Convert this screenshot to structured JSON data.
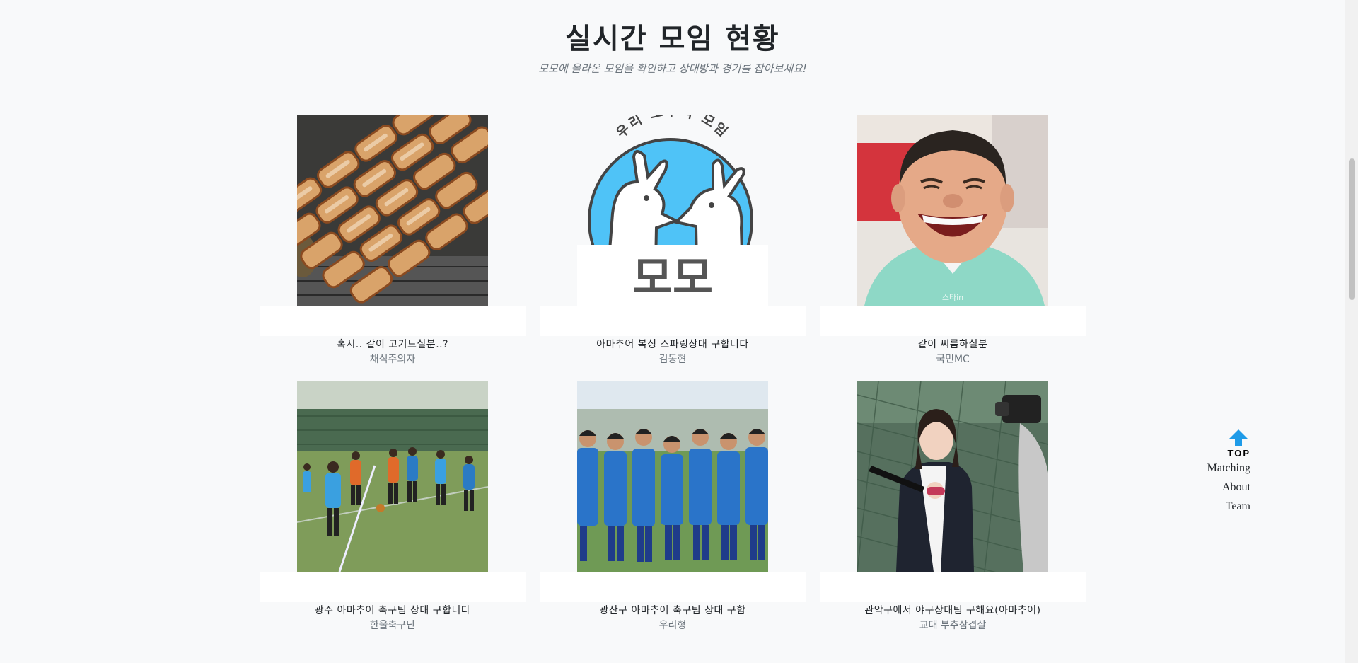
{
  "section": {
    "heading": "실시간 모임 현황",
    "subheading": "모모에 올라온 모임을 확인하고 상대방과 경기를 잡아보세요!"
  },
  "cards": [
    {
      "title": "혹시.. 같이 고기드실분..?",
      "author": "채식주의자",
      "image": "grilled-pork-belly"
    },
    {
      "title": "아마추어 복싱 스파링상대 구합니다",
      "author": "김동현",
      "image": "momo-logo"
    },
    {
      "title": "같이 씨름하실분",
      "author": "국민MC",
      "image": "laughing-man"
    },
    {
      "title": "광주 아마추어 축구팀 상대 구합니다",
      "author": "한울축구단",
      "image": "soccer-match"
    },
    {
      "title": "광산구 아마추어 축구팀 상대 구함",
      "author": "우리형",
      "image": "soccer-team"
    },
    {
      "title": "관악구에서 야구상대팀 구해요(아마추어)",
      "author": "교대 부추삼겹살",
      "image": "baseball-batter"
    }
  ],
  "logo": {
    "arc_text": "우리 모두의 모임",
    "wordmark": "모모"
  },
  "watermark": "스타in",
  "side_nav": {
    "top_label": "TOP",
    "links": [
      "Matching",
      "About",
      "Team"
    ]
  },
  "colors": {
    "background": "#f8f9fa",
    "logo_blue": "#4fc3f7",
    "top_arrow": "#1e9be8"
  }
}
